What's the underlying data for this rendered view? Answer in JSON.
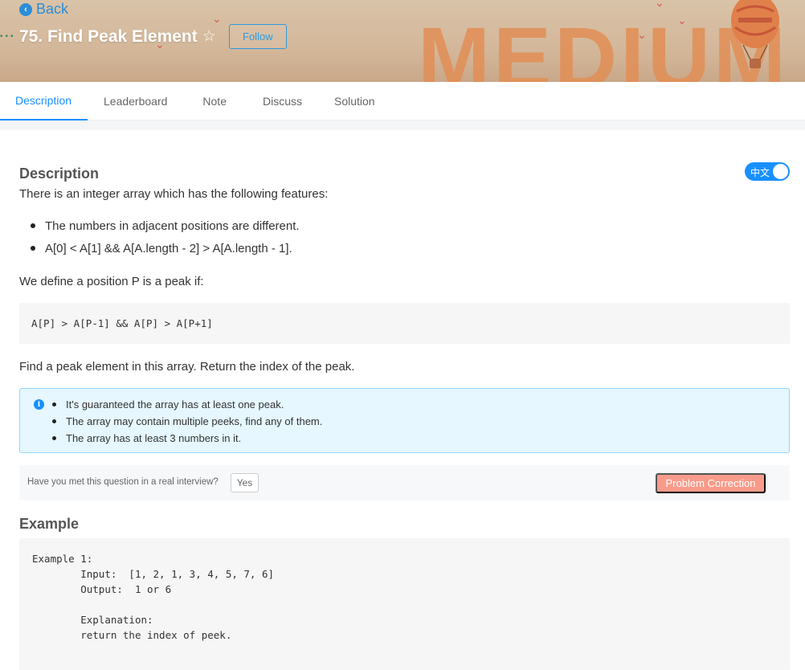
{
  "header": {
    "back_label": "Back",
    "title": "75. Find Peak Element",
    "follow_label": "Follow",
    "banner_word": "MEDIUM"
  },
  "tabs": [
    {
      "label": "Description",
      "active": true
    },
    {
      "label": "Leaderboard",
      "active": false
    },
    {
      "label": "Note",
      "active": false
    },
    {
      "label": "Discuss",
      "active": false
    },
    {
      "label": "Solution",
      "active": false
    }
  ],
  "description": {
    "heading": "Description",
    "language_toggle": "中文",
    "intro": "There is an integer array which has the following features:",
    "features": [
      "The numbers in adjacent positions are different.",
      "A[0] < A[1] && A[A.length - 2] > A[A.length - 1]."
    ],
    "define": "We define a position P is a peak if:",
    "peak_formula": "A[P] > A[P-1] && A[P] > A[P+1]",
    "task": "Find a peak element in this array. Return the index of the peak.",
    "notes": [
      "It's guaranteed the array has at least one peak.",
      "The array may contain multiple peeks, find any of them.",
      "The array has at least 3 numbers in it."
    ]
  },
  "interview": {
    "question": "Have you met this question in a real interview?",
    "yes_label": "Yes",
    "correction_label": "Problem Correction"
  },
  "example": {
    "heading": "Example",
    "code": "Example 1:\n\tInput:  [1, 2, 1, 3, 4, 5, 7, 6]\n\tOutput:  1 or 6\n\t\n\tExplanation:\n\treturn the index of peek."
  },
  "colors": {
    "accent": "#1890ff",
    "banner": "#d4b79a",
    "banner_word": "#e28e55",
    "correction": "#f99b8a"
  }
}
